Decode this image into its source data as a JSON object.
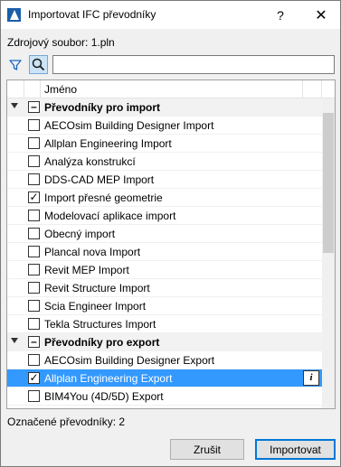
{
  "window": {
    "title": "Importovat IFC převodníky",
    "help_glyph": "?",
    "close_glyph": "✕"
  },
  "source": {
    "label": "Zdrojový soubor: 1.pln"
  },
  "search": {
    "value": "",
    "placeholder": ""
  },
  "list": {
    "column_header": "Jméno",
    "rows": [
      {
        "type": "group",
        "label": "Převodníky pro import",
        "state": "partial"
      },
      {
        "type": "item",
        "label": "AECOsim Building Designer Import",
        "checked": false
      },
      {
        "type": "item",
        "label": "Allplan Engineering Import",
        "checked": false
      },
      {
        "type": "item",
        "label": "Analýza konstrukcí",
        "checked": false
      },
      {
        "type": "item",
        "label": "DDS-CAD MEP Import",
        "checked": false
      },
      {
        "type": "item",
        "label": "Import přesné geometrie",
        "checked": true
      },
      {
        "type": "item",
        "label": "Modelovací aplikace import",
        "checked": false
      },
      {
        "type": "item",
        "label": "Obecný import",
        "checked": false
      },
      {
        "type": "item",
        "label": "Plancal nova Import",
        "checked": false
      },
      {
        "type": "item",
        "label": "Revit MEP Import",
        "checked": false
      },
      {
        "type": "item",
        "label": "Revit Structure Import",
        "checked": false
      },
      {
        "type": "item",
        "label": "Scia Engineer Import",
        "checked": false
      },
      {
        "type": "item",
        "label": "Tekla Structures Import",
        "checked": false
      },
      {
        "type": "group",
        "label": "Převodníky pro export",
        "state": "partial"
      },
      {
        "type": "item",
        "label": "AECOsim Building Designer Export",
        "checked": false
      },
      {
        "type": "item",
        "label": "Allplan Engineering Export",
        "checked": true,
        "selected": true
      },
      {
        "type": "item",
        "label": "BIM4You (4D/5D) Export",
        "checked": false
      },
      {
        "type": "item",
        "label": "",
        "checked": false
      }
    ]
  },
  "status": {
    "label": "Označené převodníky: 2"
  },
  "buttons": {
    "cancel": "Zrušit",
    "import": "Importovat"
  },
  "icons": {
    "check": "✓",
    "partial": "–",
    "info": "i"
  },
  "colors": {
    "selection": "#3399ff",
    "primary_button_border": "#0078d7",
    "search_toggle_bg": "#cce4f7"
  }
}
